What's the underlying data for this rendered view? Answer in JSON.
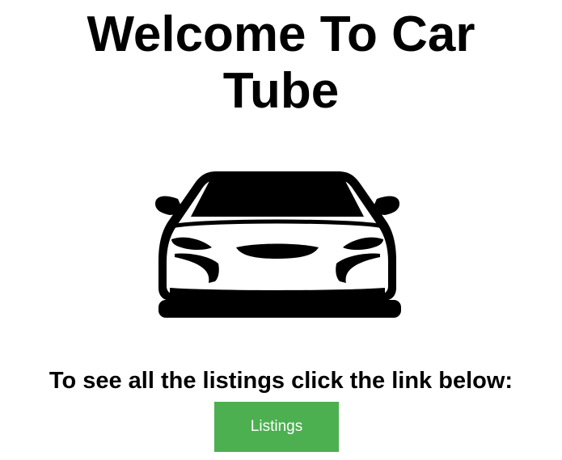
{
  "header": {
    "title_line1": "Welcome To Car",
    "title_line2": "Tube"
  },
  "logo": {
    "icon": "car-front-icon",
    "color": "#000000"
  },
  "main": {
    "prompt": "To see all the listings click the link below:",
    "listings_button_label": "Listings",
    "button_color": "#4caf50",
    "button_text_color": "#ffffff"
  }
}
